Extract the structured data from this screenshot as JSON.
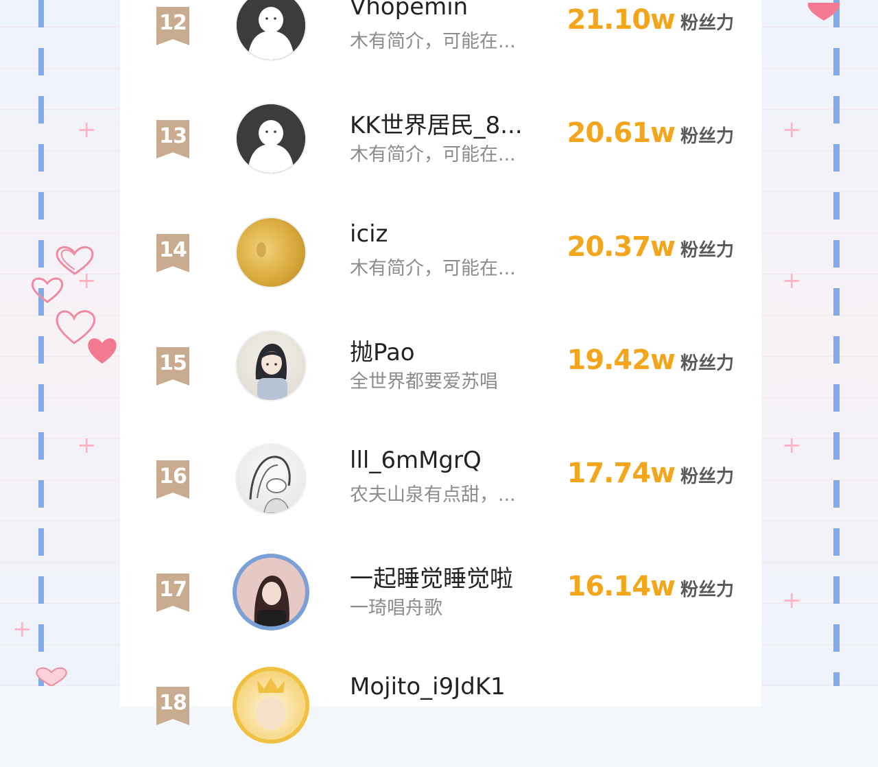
{
  "ranking": {
    "rows": [
      {
        "rank": "12",
        "name": "Vhopemin",
        "bio": "木有简介，可能在...",
        "score": "21.10w",
        "unit": "粉丝力",
        "avatar": "default-avatar"
      },
      {
        "rank": "13",
        "name": "KK世界居民_8...",
        "bio": "木有简介，可能在...",
        "score": "20.61w",
        "unit": "粉丝力",
        "avatar": "default-avatar"
      },
      {
        "rank": "14",
        "name": "iciz",
        "bio": "木有简介，可能在...",
        "score": "20.37w",
        "unit": "粉丝力",
        "avatar": "photo-avatar"
      },
      {
        "rank": "15",
        "name": "抛Pao",
        "bio": "全世界都要爱苏唱",
        "score": "19.42w",
        "unit": "粉丝力",
        "avatar": "anime-avatar"
      },
      {
        "rank": "16",
        "name": "lll_6mMgrQ",
        "bio": "农夫山泉有点甜，...",
        "score": "17.74w",
        "unit": "粉丝力",
        "avatar": "sketch-avatar"
      },
      {
        "rank": "17",
        "name": "一起睡觉睡觉啦",
        "bio": "一琦唱舟歌",
        "score": "16.14w",
        "unit": "粉丝力",
        "avatar": "photo-avatar"
      },
      {
        "rank": "18",
        "name": "Mojito_i9JdK1",
        "bio": "",
        "score": "",
        "unit": "",
        "avatar": "crown-avatar"
      }
    ]
  },
  "colors": {
    "rank_badge": "#c9ac8f",
    "score": "#f3a51c",
    "name": "#222222",
    "bio": "#8c8c8c"
  }
}
